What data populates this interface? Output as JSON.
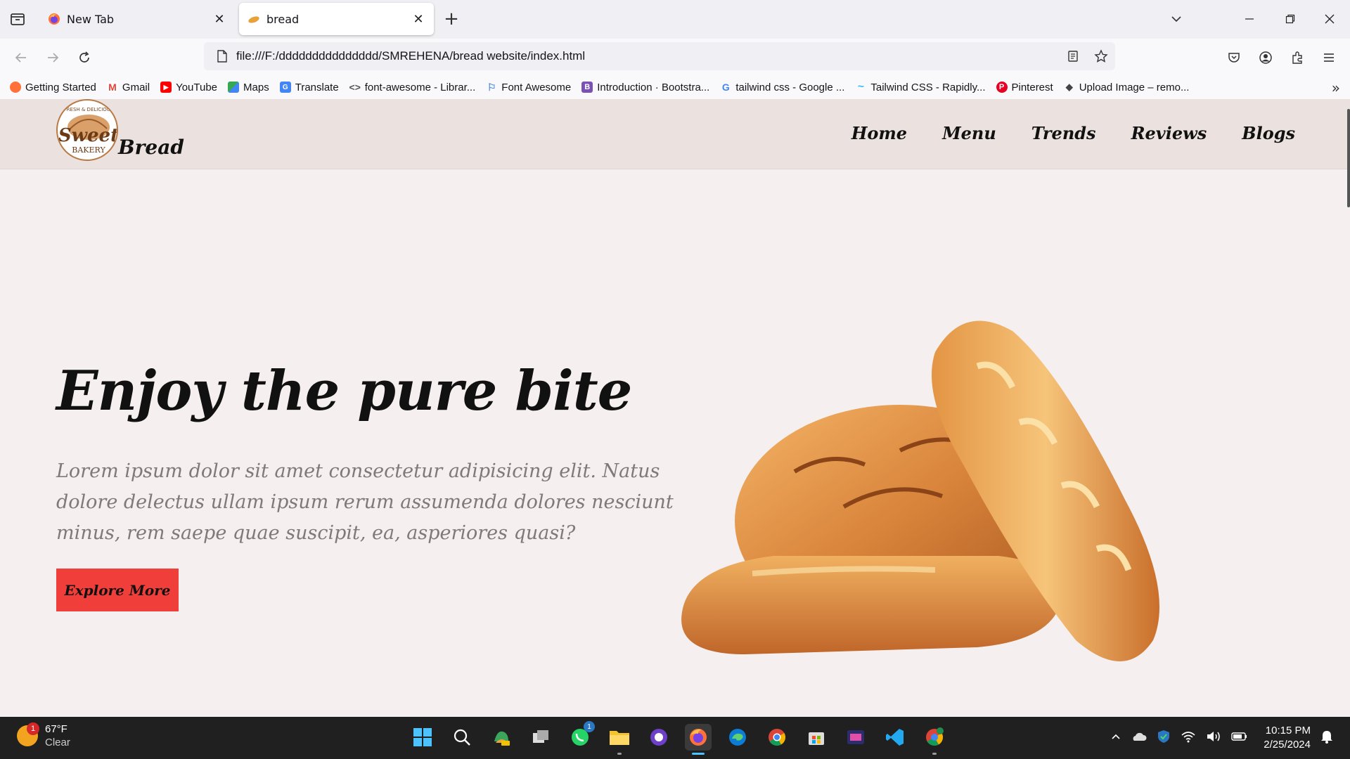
{
  "browser": {
    "tabs": [
      {
        "title": "New Tab",
        "active": false,
        "favicon": "firefox-icon"
      },
      {
        "title": "bread",
        "active": true,
        "favicon": "bread-favicon"
      }
    ],
    "url": "file:///F:/ddddddddddddddd/SMREHENA/bread website/index.html",
    "bookmarks": [
      {
        "label": "Getting Started",
        "icon": "firefox-icon",
        "color": "#e66000"
      },
      {
        "label": "Gmail",
        "icon": "gmail-icon",
        "color": "#ea4335"
      },
      {
        "label": "YouTube",
        "icon": "youtube-icon",
        "color": "#ff0000"
      },
      {
        "label": "Maps",
        "icon": "maps-icon",
        "color": "#34a853"
      },
      {
        "label": "Translate",
        "icon": "translate-icon",
        "color": "#4285f4"
      },
      {
        "label": "font-awesome - Librar...",
        "icon": "code-icon",
        "color": "#666666"
      },
      {
        "label": "Font Awesome",
        "icon": "flag-icon",
        "color": "#528dd7"
      },
      {
        "label": "Introduction · Bootstra...",
        "icon": "bootstrap-icon",
        "color": "#7952b3"
      },
      {
        "label": "tailwind css - Google ...",
        "icon": "google-icon",
        "color": "#4285f4"
      },
      {
        "label": "Tailwind CSS - Rapidly...",
        "icon": "tailwind-icon",
        "color": "#38bdf8"
      },
      {
        "label": "Pinterest",
        "icon": "pinterest-icon",
        "color": "#e60023"
      },
      {
        "label": "Upload Image – remo...",
        "icon": "layers-icon",
        "color": "#444444"
      }
    ]
  },
  "site": {
    "logo": {
      "top_text": "FRESH & DELICIOUS",
      "main": "Sweet",
      "sub": "BAKERY"
    },
    "brand": "Bread",
    "menu": [
      "Home",
      "Menu",
      "Trends",
      "Reviews",
      "Blogs"
    ],
    "hero": {
      "title": "Enjoy the pure bite",
      "text": "Lorem ipsum dolor sit amet consectetur adipisicing elit. Natus dolore delectus ullam ipsum rerum assumenda dolores nesciunt minus, rem saepe quae suscipit, ea, asperiores quasi?",
      "cta": "Explore More"
    },
    "accent_color": "#f03e3a",
    "header_bg": "#ebe2df"
  },
  "taskbar": {
    "weather": {
      "temp": "67°F",
      "condition": "Clear",
      "badge": "1"
    },
    "whatsapp_badge": "1",
    "clock": {
      "time": "10:15 PM",
      "date": "2/25/2024"
    }
  }
}
